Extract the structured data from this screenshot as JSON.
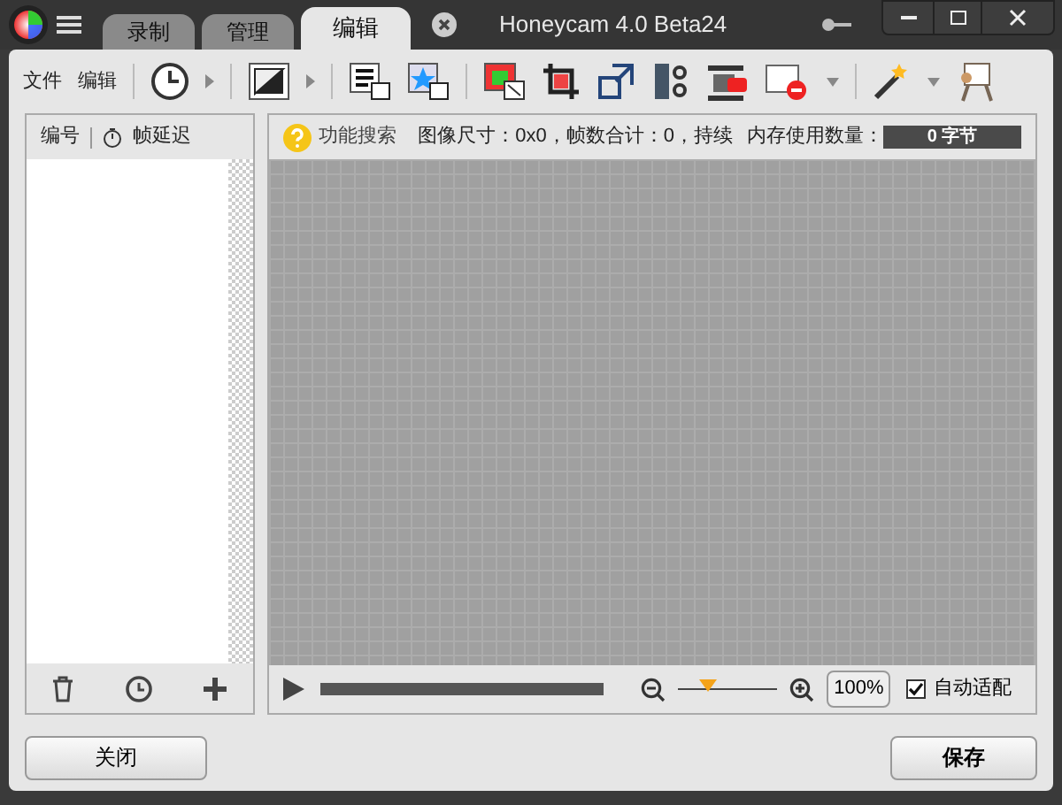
{
  "window": {
    "title": "Honeycam 4.0 Beta24"
  },
  "tabs": [
    {
      "label": "录制",
      "selected": false
    },
    {
      "label": "管理",
      "selected": false
    },
    {
      "label": "编辑",
      "selected": true
    }
  ],
  "toolbar": {
    "menus": [
      "文件",
      "编辑"
    ]
  },
  "frame_list": {
    "columns": [
      "编号",
      "帧延迟"
    ]
  },
  "info_bar": {
    "search_label": "功能搜索",
    "image_info": "图像尺寸：0x0，帧数合计：0，持续",
    "memory_label": "内存使用数量：",
    "memory_value": "0 字节"
  },
  "playback": {
    "zoom": {
      "level": 0.3
    },
    "zoom_value": "100%",
    "auto_fit": {
      "label": "自动适配",
      "checked": true
    }
  },
  "buttons": {
    "close": "关闭",
    "save": "保存"
  }
}
